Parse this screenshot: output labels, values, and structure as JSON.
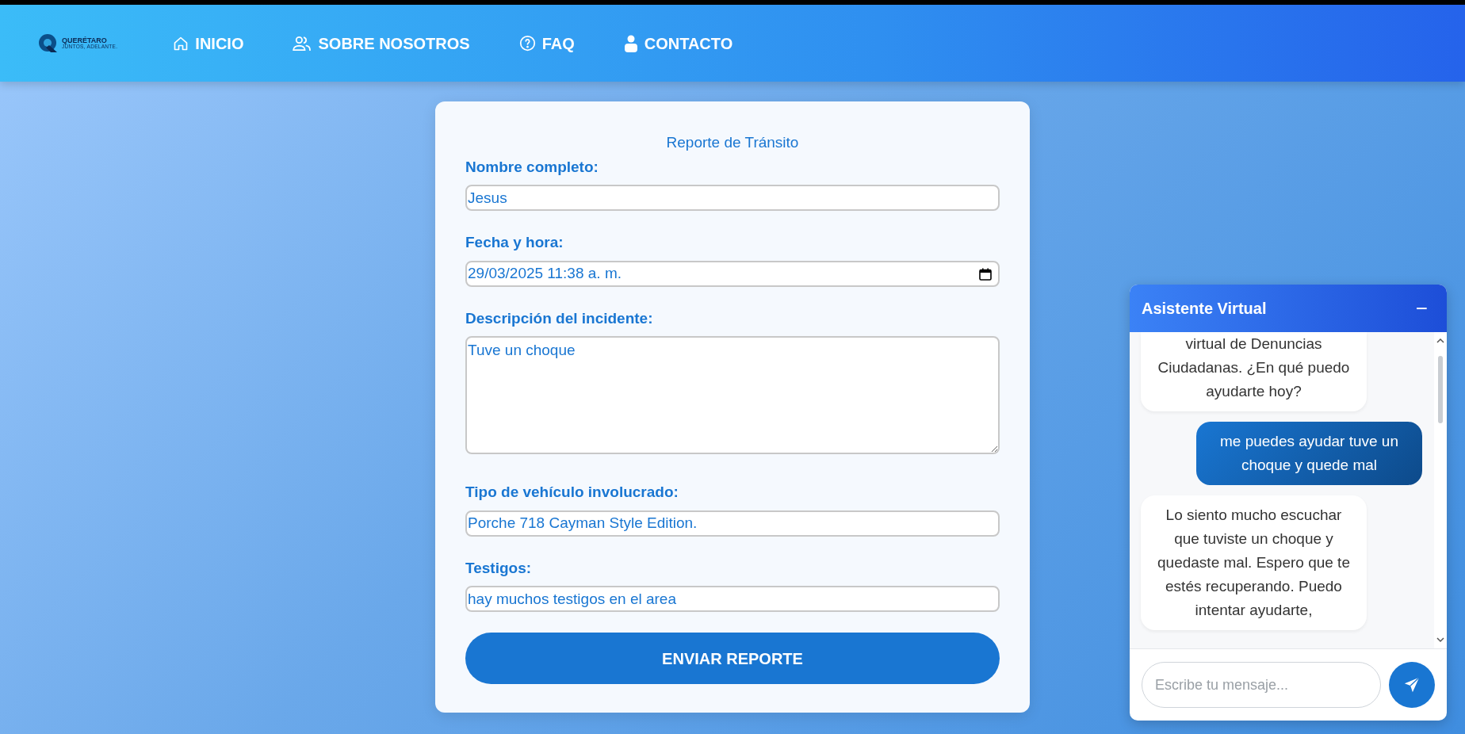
{
  "navbar": {
    "logo": {
      "name": "QUERÉTARO",
      "tagline": "JUNTOS, ADELANTE."
    },
    "items": [
      {
        "label": "INICIO"
      },
      {
        "label": "SOBRE NOSOTROS"
      },
      {
        "label": "FAQ"
      },
      {
        "label": "CONTACTO"
      }
    ]
  },
  "form": {
    "title": "Reporte de Tránsito",
    "fields": [
      {
        "kind": "text",
        "label": "Nombre completo:",
        "value": "Jesus"
      },
      {
        "kind": "datetime",
        "label": "Fecha y hora:",
        "value": "29/03/2025 11:38 a. m."
      },
      {
        "kind": "textarea",
        "label": "Descripción del incidente:",
        "value": "Tuve un choque"
      },
      {
        "kind": "text",
        "label": "Tipo de vehículo involucrado:",
        "value": "Porche 718 Cayman Style Edition."
      },
      {
        "kind": "text",
        "label": "Testigos:",
        "value": "hay muchos testigos en el area"
      }
    ],
    "submit": "ENVIAR REPORTE"
  },
  "chat": {
    "title": "Asistente Virtual",
    "minimize": "−",
    "messages": [
      {
        "kind": "bot",
        "text": "virtual de Denuncias Ciudadanas. ¿En qué puedo ayudarte hoy?"
      },
      {
        "kind": "user",
        "text": "me puedes ayudar tuve un choque y quede mal"
      },
      {
        "kind": "bot",
        "text": "Lo siento mucho escuchar que tuviste un choque y quedaste mal. Espero que te estés recuperando. Puedo intentar ayudarte,"
      }
    ],
    "input": {
      "placeholder": "Escribe tu mensaje..."
    }
  }
}
